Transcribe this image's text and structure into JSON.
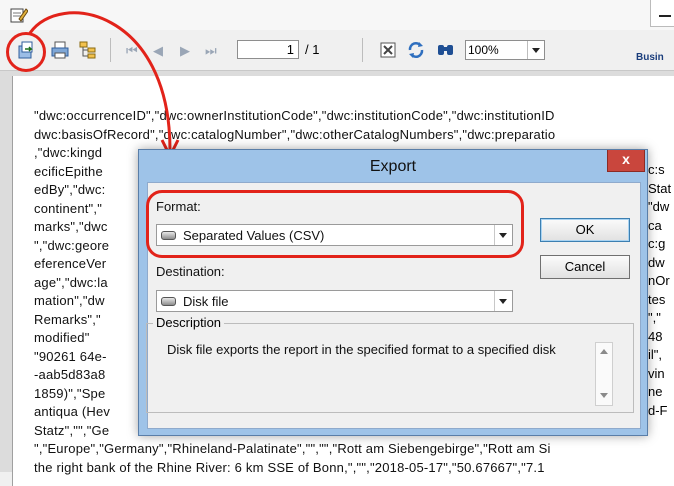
{
  "toolbar": {
    "page_current": "1",
    "page_total": "/ 1",
    "zoom": "100%",
    "brand": "Busin"
  },
  "report_lines": [
    "\"dwc:occurrenceID\",\"dwc:ownerInstitutionCode\",\"dwc:institutionCode\",\"dwc:institutionID",
    "dwc:basisOfRecord\",\"dwc:catalogNumber\",\"dwc:otherCatalogNumbers\",\"dwc:preparatio",
    ",\"dwc:kingd",
    "ecificEpithe",
    "edBy\",\"dwc:",
    "continent\",\"",
    "marks\",\"dwc",
    "\",\"dwc:geore",
    "eferenceVer",
    "age\",\"dwc:la",
    "mation\",\"dw",
    "Remarks\",\"",
    "modified\"",
    "\"90261 64e-",
    "-aab5d83a8",
    "1859)\",\"Spe",
    "antiqua (Hev",
    "Statz\",\"\",\"Ge",
    "\",\"Europe\",\"Germany\",\"Rhineland-Palatinate\",\"\",\"\",\"Rott am Siebengebirge\",\"Rott am Si",
    "the right bank of the Rhine River: 6 km SSE of Bonn,\",\"\",\"2018-05-17\",\"50.67667\",\"7.1"
  ],
  "report_right": [
    "c:s",
    "Stat",
    "\"dw",
    "ca",
    "c:g",
    "dw",
    "nOr",
    "tes",
    "\",\"",
    "48",
    "il\",",
    "vin",
    "ne",
    "d-F"
  ],
  "dialog": {
    "title": "Export",
    "close_label": "x",
    "format_label": "Format:",
    "format_value": "Separated Values (CSV)",
    "destination_label": "Destination:",
    "destination_value": "Disk file",
    "ok_label": "OK",
    "cancel_label": "Cancel",
    "description_label": "Description",
    "description_text": "Disk file exports the report in the specified format to a specified disk"
  }
}
